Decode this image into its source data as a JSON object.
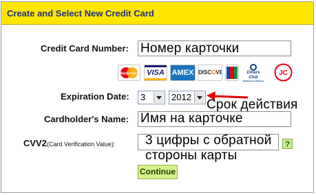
{
  "header": {
    "title": "Create and Select New Credit Card"
  },
  "form": {
    "card_number_label": "Credit Card Number:",
    "card_number_overlay": "Номер карточки",
    "expiration_label": "Expiration Date:",
    "exp_month": "3",
    "exp_year": "2012",
    "expiration_overlay": "Срок действия",
    "cardholder_label": "Cardholder's Name:",
    "cardholder_overlay": "Имя на карточке",
    "cvv_label": "CVV2",
    "cvv_hint": "(Card Verification Value):",
    "cvv_overlay_line1": "3 цифры с обратной",
    "cvv_overlay_line2": "стороны карты",
    "help_label": "?",
    "continue_label": "Continue"
  },
  "cards": [
    {
      "name": "MasterCard",
      "icon": "mastercard-logo"
    },
    {
      "name": "VISA",
      "icon": "visa-logo"
    },
    {
      "name": "AMEX",
      "icon": "amex-logo"
    },
    {
      "name": "DISCOVER",
      "icon": "discover-logo"
    },
    {
      "name": "JCB",
      "icon": "jcb-logo"
    },
    {
      "name": "Diners Club International",
      "icon": "diners-club-logo"
    },
    {
      "name": "JC",
      "icon": "jc-logo"
    }
  ],
  "colors": {
    "header_bg": "#ffe600",
    "header_text": "#1f2f7a",
    "arrow": "#e00000",
    "button_bg": "#d6f08a"
  }
}
